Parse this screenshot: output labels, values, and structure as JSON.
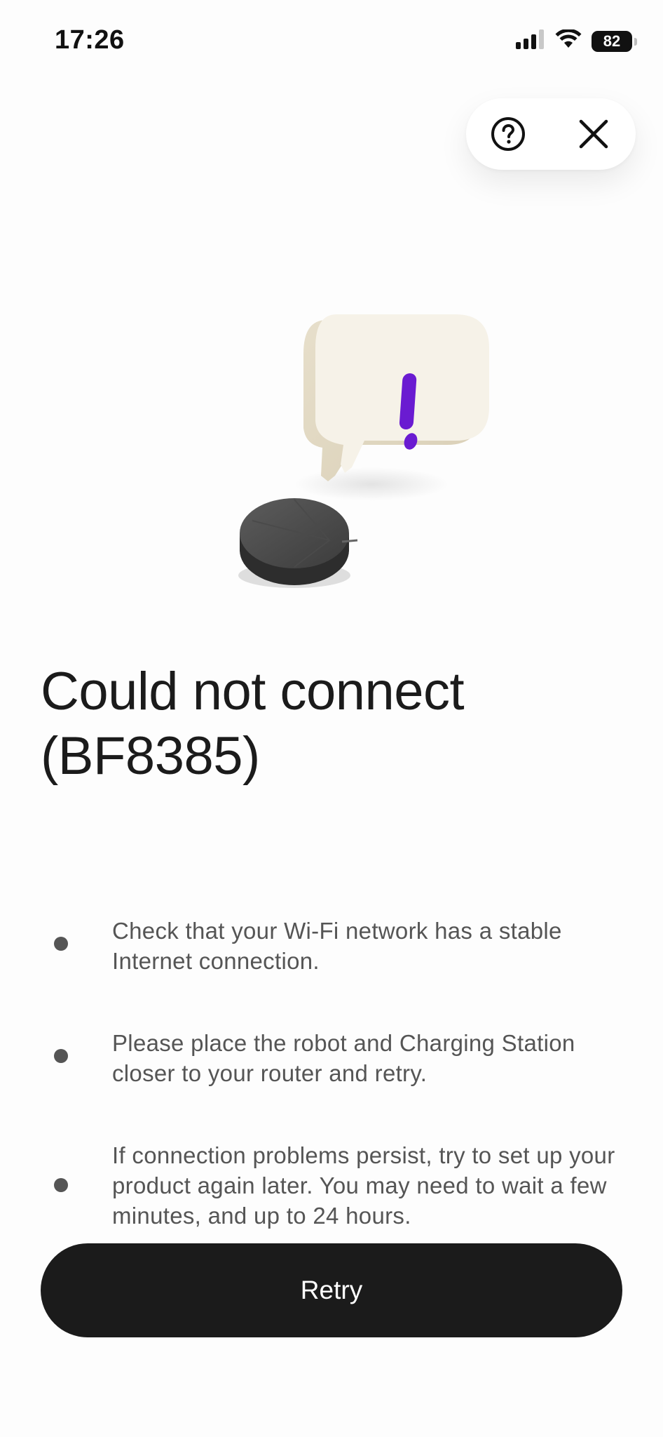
{
  "status_bar": {
    "time": "17:26",
    "battery_level": "82",
    "icons": [
      "cellular-signal-icon",
      "wifi-icon",
      "battery-icon"
    ]
  },
  "toolbar": {
    "help_icon": "help-circle-icon",
    "close_icon": "close-icon"
  },
  "illustration": {
    "subject": "robot vacuum with speech bubble showing exclamation mark",
    "accent_color": "#6a1bd1",
    "bubble_color": "#f6f2e8"
  },
  "error": {
    "title": "Could not connect (BF8385)"
  },
  "tips": [
    {
      "text": "Check that your Wi-Fi network has a stable Internet connection."
    },
    {
      "text": "Please place the robot and Charging Station closer to your router and retry."
    },
    {
      "text": "If connection problems persist, try to set up your product again later. You may need to wait a few minutes, and up to 24 hours."
    }
  ],
  "actions": {
    "retry_label": "Retry"
  },
  "colors": {
    "primary_button": "#1b1b1b",
    "background": "#fdfdfd",
    "body_text": "#555555"
  }
}
